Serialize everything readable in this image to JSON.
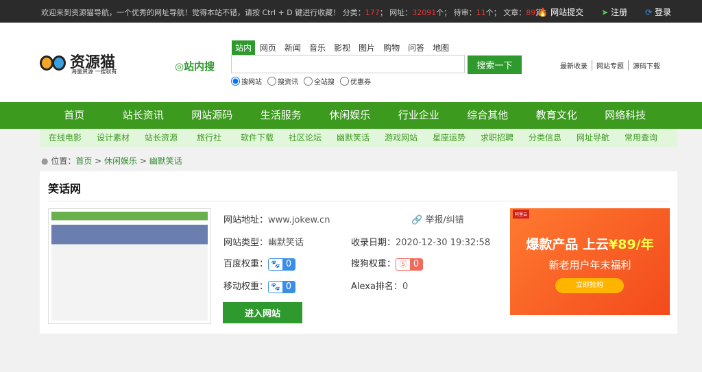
{
  "topbar": {
    "msg_a": "欢迎来到资源猫导航，一个优秀的网址导航！觉得本站不错，请按 Ctrl + D 键进行收藏！ 分类：",
    "cat_count": "177",
    "msg_b": "； 网址：",
    "url_count": "32091",
    "msg_c": "个； 待审：",
    "pending": "11",
    "msg_d": "个； 文章：",
    "articles": "89",
    "msg_e": "篇；",
    "links": [
      "网站提交",
      "注册",
      "登录"
    ]
  },
  "logo": {
    "name": "资源猫",
    "slogan": "海量资源 一搜就有"
  },
  "search": {
    "brand": "站内搜",
    "tabs": [
      "站内",
      "网页",
      "新闻",
      "音乐",
      "影视",
      "图片",
      "购物",
      "问答",
      "地图"
    ],
    "active_tab": 0,
    "value": "",
    "button": "搜索一下",
    "radios": [
      "搜网站",
      "搜资讯",
      "全站搜",
      "优惠券"
    ],
    "selected_radio": 0
  },
  "header_links": [
    "最新收录",
    "网站专题",
    "源码下载"
  ],
  "nav": [
    "首页",
    "站长资讯",
    "网站源码",
    "生活服务",
    "休闲娱乐",
    "行业企业",
    "综合其他",
    "教育文化",
    "网络科技"
  ],
  "subnav": [
    "在线电影",
    "设计素材",
    "站长资源",
    "旅行社",
    "软件下载",
    "社区论坛",
    "幽默笑话",
    "游戏网站",
    "星座运势",
    "求职招聘",
    "分类信息",
    "网址导航",
    "常用查询"
  ],
  "breadcrumb": {
    "label": "位置：",
    "items": [
      "首页",
      "休闲娱乐",
      "幽默笑话"
    ],
    "sep": " > "
  },
  "site": {
    "title": "笑话网",
    "url_label": "网站地址：",
    "url": "www.jokew.cn",
    "report": "举报/纠错",
    "type_label": "网站类型：",
    "type": "幽默笑话",
    "date_label": "收录日期：",
    "date": "2020-12-30 19:32:58",
    "baidu_label": "百度权重：",
    "baidu": "0",
    "sogou_label": "搜狗权重：",
    "sogou": "0",
    "mobile_label": "移动权重：",
    "mobile": "0",
    "alexa_label": "Alexa排名：",
    "alexa": "0",
    "visit": "进入网站"
  },
  "ad": {
    "brand": "阿里云",
    "line1": "爆款产品 上云",
    "price": "¥89/年",
    "line2": "新老用户年末福利",
    "button": "立即抢购"
  },
  "colors": {
    "green": "#3c9a1e",
    "topbar": "#2b2b2b",
    "red": "#e33"
  }
}
